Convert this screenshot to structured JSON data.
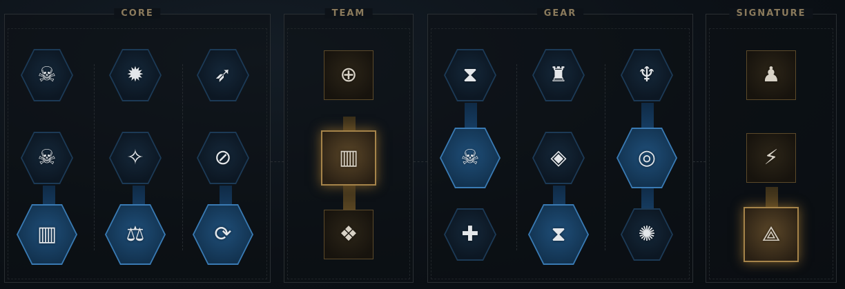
{
  "panels": {
    "core": {
      "title": "CORE"
    },
    "team": {
      "title": "TEAM"
    },
    "gear": {
      "title": "GEAR"
    },
    "signature": {
      "title": "SIGNATURE"
    }
  },
  "nodes": {
    "core": [
      {
        "icon": "squad-defense-icon",
        "glyph": "☠",
        "active": false
      },
      {
        "icon": "flame-upgrade-icon",
        "glyph": "✹",
        "active": false
      },
      {
        "icon": "boot-strike-icon",
        "glyph": "➶",
        "active": false
      },
      {
        "icon": "squad-ammo-icon",
        "glyph": "☠",
        "active": false
      },
      {
        "icon": "helix-burst-icon",
        "glyph": "✧",
        "active": false
      },
      {
        "icon": "no-melee-icon",
        "glyph": "⊘",
        "active": false
      },
      {
        "icon": "squad-barricade-icon",
        "glyph": "▥",
        "active": true
      },
      {
        "icon": "helix-weight-icon",
        "glyph": "⚖",
        "active": true
      },
      {
        "icon": "weapon-reload-icon",
        "glyph": "⟳",
        "active": true
      }
    ],
    "team": [
      {
        "icon": "team-target-icon",
        "glyph": "⊕",
        "active": false
      },
      {
        "icon": "barricade-upgrade-icon",
        "glyph": "▥",
        "active": true
      },
      {
        "icon": "winged-helix-icon",
        "glyph": "❖",
        "active": false
      }
    ],
    "gear": [
      {
        "icon": "hourglass-shield-icon",
        "glyph": "⧗",
        "active": false
      },
      {
        "icon": "armor-shield-icon",
        "glyph": "♜",
        "active": false
      },
      {
        "icon": "rank-wings-icon",
        "glyph": "♆",
        "active": false
      },
      {
        "icon": "squad-barricade-icon",
        "glyph": "☠",
        "active": true
      },
      {
        "icon": "rotating-shield-icon",
        "glyph": "◈",
        "active": false
      },
      {
        "icon": "target-cycle-icon",
        "glyph": "◎",
        "active": true
      },
      {
        "icon": "shield-plus-icon",
        "glyph": "✚",
        "active": false
      },
      {
        "icon": "hourglass-plus-icon",
        "glyph": "⧗",
        "active": true
      },
      {
        "icon": "explosion-icon",
        "glyph": "✺",
        "active": false
      }
    ],
    "signature": [
      {
        "icon": "power-armor-icon",
        "glyph": "♟",
        "active": false
      },
      {
        "icon": "charge-weapon-icon",
        "glyph": "⚡",
        "active": false
      },
      {
        "icon": "emblem-icon",
        "glyph": "⟁",
        "active": true
      }
    ]
  },
  "colors": {
    "hex_border": "#1c3a56",
    "hex_active": "#3a7bb4",
    "square_border": "#5c4a2a",
    "square_active": "#a6844a",
    "title": "#8a7a5c"
  }
}
